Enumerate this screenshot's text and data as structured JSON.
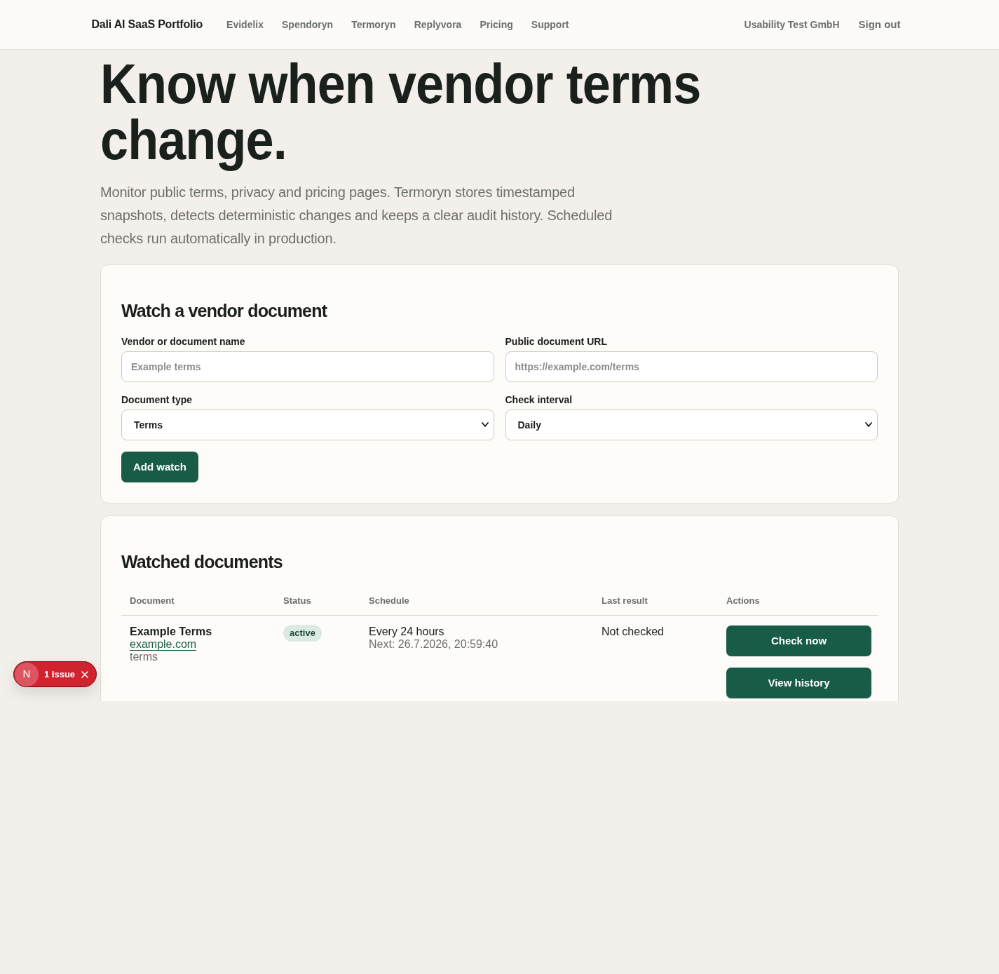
{
  "navbar": {
    "brand": "Dali AI SaaS Portfolio",
    "links": [
      "Evidelix",
      "Spendoryn",
      "Termoryn",
      "Replyvora",
      "Pricing",
      "Support"
    ],
    "account": "Usability Test GmbH",
    "sign_out": "Sign out"
  },
  "hero": {
    "title": "Know when vendor terms change.",
    "description": "Monitor public terms, privacy and pricing pages. Termoryn stores timestamped snapshots, detects deterministic changes and keeps a clear audit history. Scheduled checks run automatically in production."
  },
  "watch_form": {
    "title": "Watch a vendor document",
    "fields": [
      {
        "kind": "text",
        "label": "Vendor or document name",
        "placeholder": "Example terms"
      },
      {
        "kind": "text",
        "label": "Public document URL",
        "placeholder": "https://example.com/terms"
      },
      {
        "kind": "select",
        "label": "Document type",
        "value": "Terms"
      },
      {
        "kind": "select",
        "label": "Check interval",
        "value": "Daily"
      }
    ],
    "submit": "Add watch"
  },
  "watched": {
    "title": "Watched documents",
    "table": {
      "columns": [
        "Document",
        "Status",
        "Schedule",
        "Last result",
        "Actions"
      ],
      "rows": [
        {
          "document": {
            "name": "Example Terms",
            "domain": "example.com",
            "type": "terms"
          },
          "status": "active",
          "schedule": "Every 24 hours",
          "next": "Next: 26.7.2026, 20:59:40",
          "last_result": "Not checked",
          "actions": [
            "Check now",
            "View history"
          ]
        }
      ]
    }
  },
  "dev_indicator": {
    "letter": "N",
    "label": "1 Issue"
  }
}
